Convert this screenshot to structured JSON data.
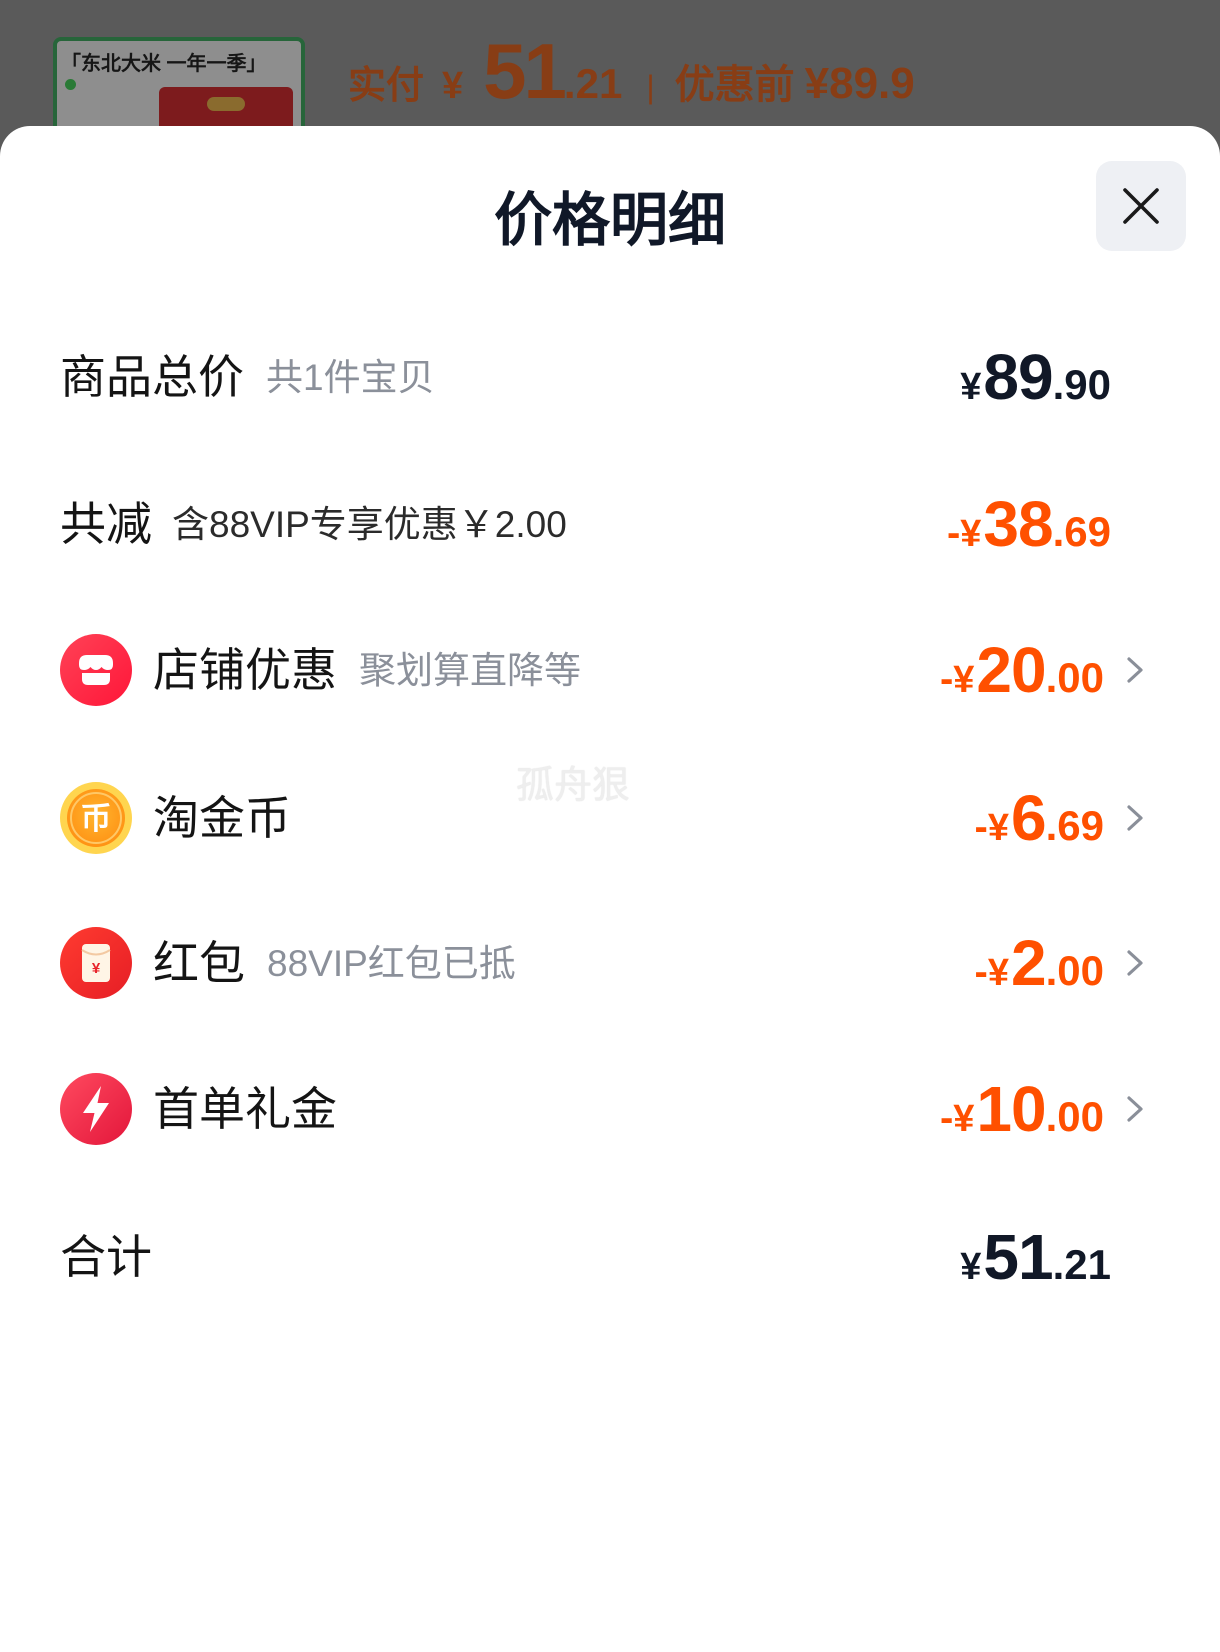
{
  "backdrop": {
    "product_thumb": {
      "title": "「东北大米 一年一季」"
    },
    "paid_label": "实付",
    "paid_currency": "¥",
    "paid_int": "51",
    "paid_dec": ".21",
    "divider": "|",
    "original_label": "优惠前",
    "original_price": "¥89.9"
  },
  "sheet": {
    "title": "价格明细",
    "close_icon": "close-icon",
    "rows": [
      {
        "label": "商品总价",
        "note": "共1件宝贝",
        "currency": "¥",
        "int": "89",
        "dec": ".90",
        "amount_color": "#111827"
      },
      {
        "label": "共减",
        "note": "含88VIP专享优惠￥2.00",
        "sign": "-",
        "currency": "¥",
        "int": "38",
        "dec": ".69",
        "amount_color": "#ff5000"
      },
      {
        "icon": "store-icon",
        "label": "店铺优惠",
        "note": "聚划算直降等",
        "sign": "-",
        "currency": "¥",
        "int": "20",
        "dec": ".00",
        "amount_color": "#ff5000"
      },
      {
        "icon": "coin-icon",
        "icon_glyph": "币",
        "label": "淘金币",
        "sign": "-",
        "currency": "¥",
        "int": "6",
        "dec": ".69",
        "amount_color": "#ff5000"
      },
      {
        "icon": "red-packet-icon",
        "icon_glyph": "¥",
        "label": "红包",
        "note": "88VIP红包已抵",
        "sign": "-",
        "currency": "¥",
        "int": "2",
        "dec": ".00",
        "amount_color": "#ff5000"
      },
      {
        "icon": "lightning-icon",
        "label": "首单礼金",
        "sign": "-",
        "currency": "¥",
        "int": "10",
        "dec": ".00",
        "amount_color": "#ff5000"
      }
    ],
    "total": {
      "label": "合计",
      "currency": "¥",
      "int": "51",
      "dec": ".21",
      "amount_color": "#111827"
    }
  },
  "watermark": "孤舟狠",
  "colors": {
    "accent": "#ff5000",
    "text_primary": "#111827",
    "text_secondary": "#8b909a",
    "backdrop": "#5a5a5a",
    "sheet_background": "#ffffff"
  }
}
